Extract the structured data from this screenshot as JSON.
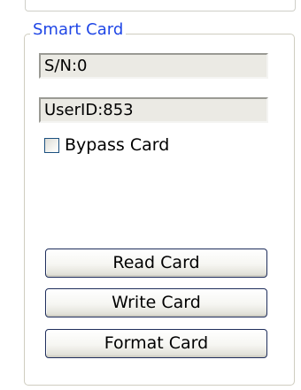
{
  "smart_card": {
    "group_title": "Smart Card",
    "serial_field": "S/N:0",
    "userid_field": "UserID:853",
    "bypass_checkbox": {
      "label": "Bypass Card",
      "checked": false
    },
    "buttons": {
      "read": "Read Card",
      "write": "Write Card",
      "format": "Format Card"
    }
  },
  "colors": {
    "group_title": "#1f46e6",
    "group_border": "#cfcdc0",
    "button_border": "#1f2e5c",
    "checkbox_border": "#1c5180",
    "readonly_bg": "#ebeae4"
  }
}
